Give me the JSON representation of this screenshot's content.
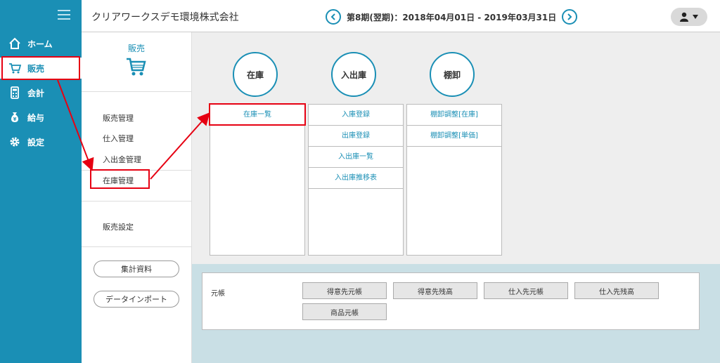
{
  "colors": {
    "brand": "#1a8fb5",
    "annotation": "#e60012"
  },
  "nav": {
    "items": [
      {
        "label": "ホーム",
        "icon": "home-icon"
      },
      {
        "label": "販売",
        "icon": "cart-icon",
        "active": true
      },
      {
        "label": "会計",
        "icon": "calculator-icon"
      },
      {
        "label": "給与",
        "icon": "money-bag-icon"
      },
      {
        "label": "設定",
        "icon": "gear-icon"
      }
    ]
  },
  "header": {
    "company": "クリアワークスデモ環境株式会社",
    "period": "第8期(翌期)：2018年04月01日 - 2019年03月31日"
  },
  "submenu": {
    "title": "販売",
    "items": [
      "販売管理",
      "仕入管理",
      "入出金管理",
      "在庫管理"
    ],
    "settings": "販売設定",
    "buttons": {
      "summary": "集計資料",
      "import": "データインポート"
    }
  },
  "categories": [
    {
      "title": "在庫",
      "links": [
        "在庫一覧"
      ]
    },
    {
      "title": "入出庫",
      "links": [
        "入庫登録",
        "出庫登録",
        "入出庫一覧",
        "入出庫推移表"
      ]
    },
    {
      "title": "棚卸",
      "links": [
        "棚卸調整[在庫]",
        "棚卸調整[単価]"
      ]
    }
  ],
  "ledger": {
    "label": "元帳",
    "buttons": [
      "得意先元帳",
      "得意先残高",
      "仕入先元帳",
      "仕入先残高",
      "商品元帳"
    ]
  }
}
